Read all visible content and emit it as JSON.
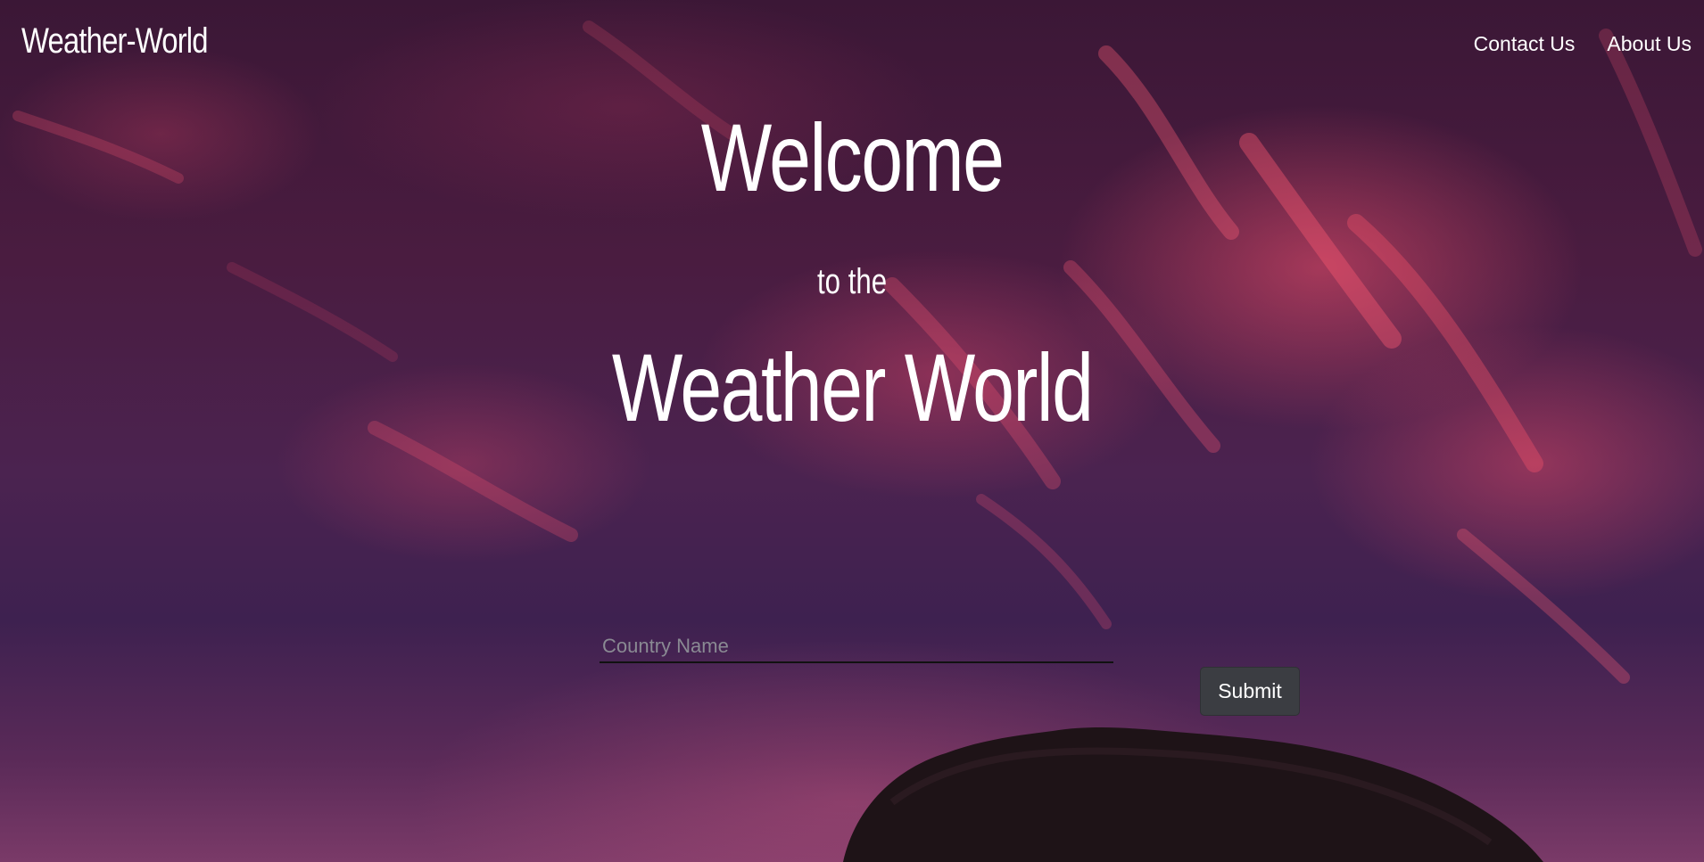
{
  "navbar": {
    "brand": "Weather-World",
    "links": [
      {
        "label": "Contact Us"
      },
      {
        "label": "About Us"
      }
    ]
  },
  "hero": {
    "line1": "Welcome",
    "line2": "to the",
    "line3": "Weather World"
  },
  "form": {
    "country_placeholder": "Country Name",
    "country_value": "",
    "submit_label": "Submit"
  },
  "colors": {
    "sky_dark": "#3b1736",
    "sky_pink": "#f0506e",
    "button_bg": "#3b3d42",
    "input_underline": "#111111"
  },
  "icons": {
    "background": "sunset-sky-image",
    "tree": "tree-silhouette"
  }
}
